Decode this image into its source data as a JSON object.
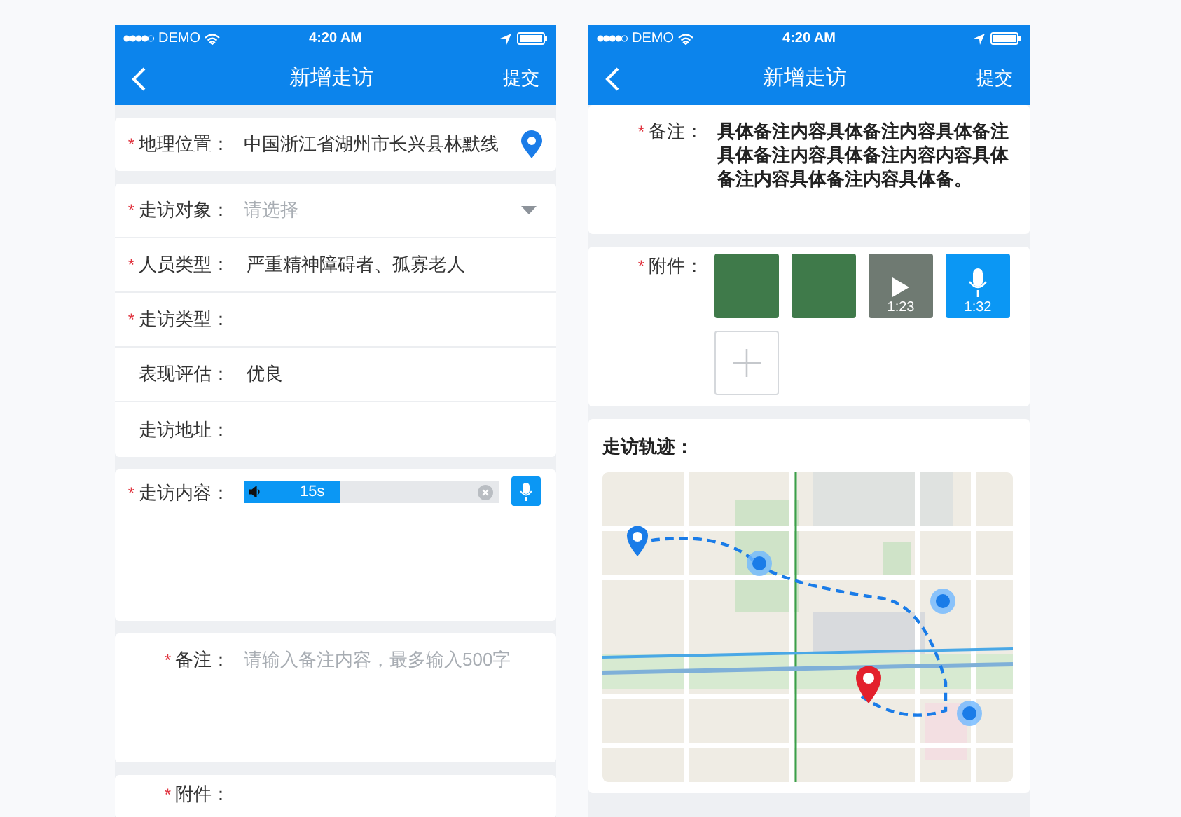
{
  "screens": [
    {
      "status_bar": {
        "carrier": "DEMO",
        "time": "4:20 AM"
      },
      "nav": {
        "title": "新增走访",
        "action": "提交"
      },
      "cards": [
        {
          "fields": [
            {
              "kind": "location",
              "label": "地理位置：",
              "required_mark": "*",
              "value": "中国浙江省湖州市长兴县林默线"
            }
          ]
        },
        {
          "fields": [
            {
              "kind": "select",
              "label": "走访对象：",
              "required_mark": "*",
              "placeholder": "请选择"
            },
            {
              "kind": "text",
              "label": "人员类型：",
              "required_mark": "*",
              "value": "严重精神障碍者、孤寡老人"
            },
            {
              "kind": "text",
              "label": "走访类型：",
              "required_mark": "*"
            },
            {
              "kind": "text",
              "label": "表现评估：",
              "value": "优良"
            },
            {
              "kind": "text",
              "label": "走访地址："
            }
          ]
        },
        {
          "fields": [
            {
              "kind": "voice",
              "label": "走访内容：",
              "required_mark": "*",
              "duration": "15s",
              "level": 0.38
            }
          ]
        },
        {
          "fields": [
            {
              "kind": "textarea",
              "label": "备注：",
              "required_mark": "*",
              "placeholder": "请输入备注内容，最多输入500字"
            }
          ]
        },
        {
          "fields": [
            {
              "kind": "attachments",
              "label": "附件：",
              "required_mark": "*"
            }
          ]
        }
      ]
    },
    {
      "status_bar": {
        "carrier": "DEMO",
        "time": "4:20 AM"
      },
      "nav": {
        "title": "新增走访",
        "action": "提交"
      },
      "cards": [
        {
          "fields": [
            {
              "kind": "textarea",
              "label": "备注：",
              "required_mark": "*",
              "value": "具体备注内容具体备注内容具体备注具体备注内容具体备注内容内容具体备注内容具体备注内容具体备。"
            }
          ]
        },
        {
          "fields": [
            {
              "kind": "attachments",
              "label": "附件：",
              "required_mark": "*",
              "items": [
                {
                  "kind": "photo"
                },
                {
                  "kind": "photo"
                },
                {
                  "kind": "video",
                  "duration": "1:23"
                },
                {
                  "kind": "audio",
                  "duration": "1:32"
                },
                {
                  "kind": "add"
                }
              ]
            }
          ]
        },
        {
          "fields": [
            {
              "kind": "map",
              "label": "走访轨迹："
            }
          ]
        }
      ]
    }
  ]
}
